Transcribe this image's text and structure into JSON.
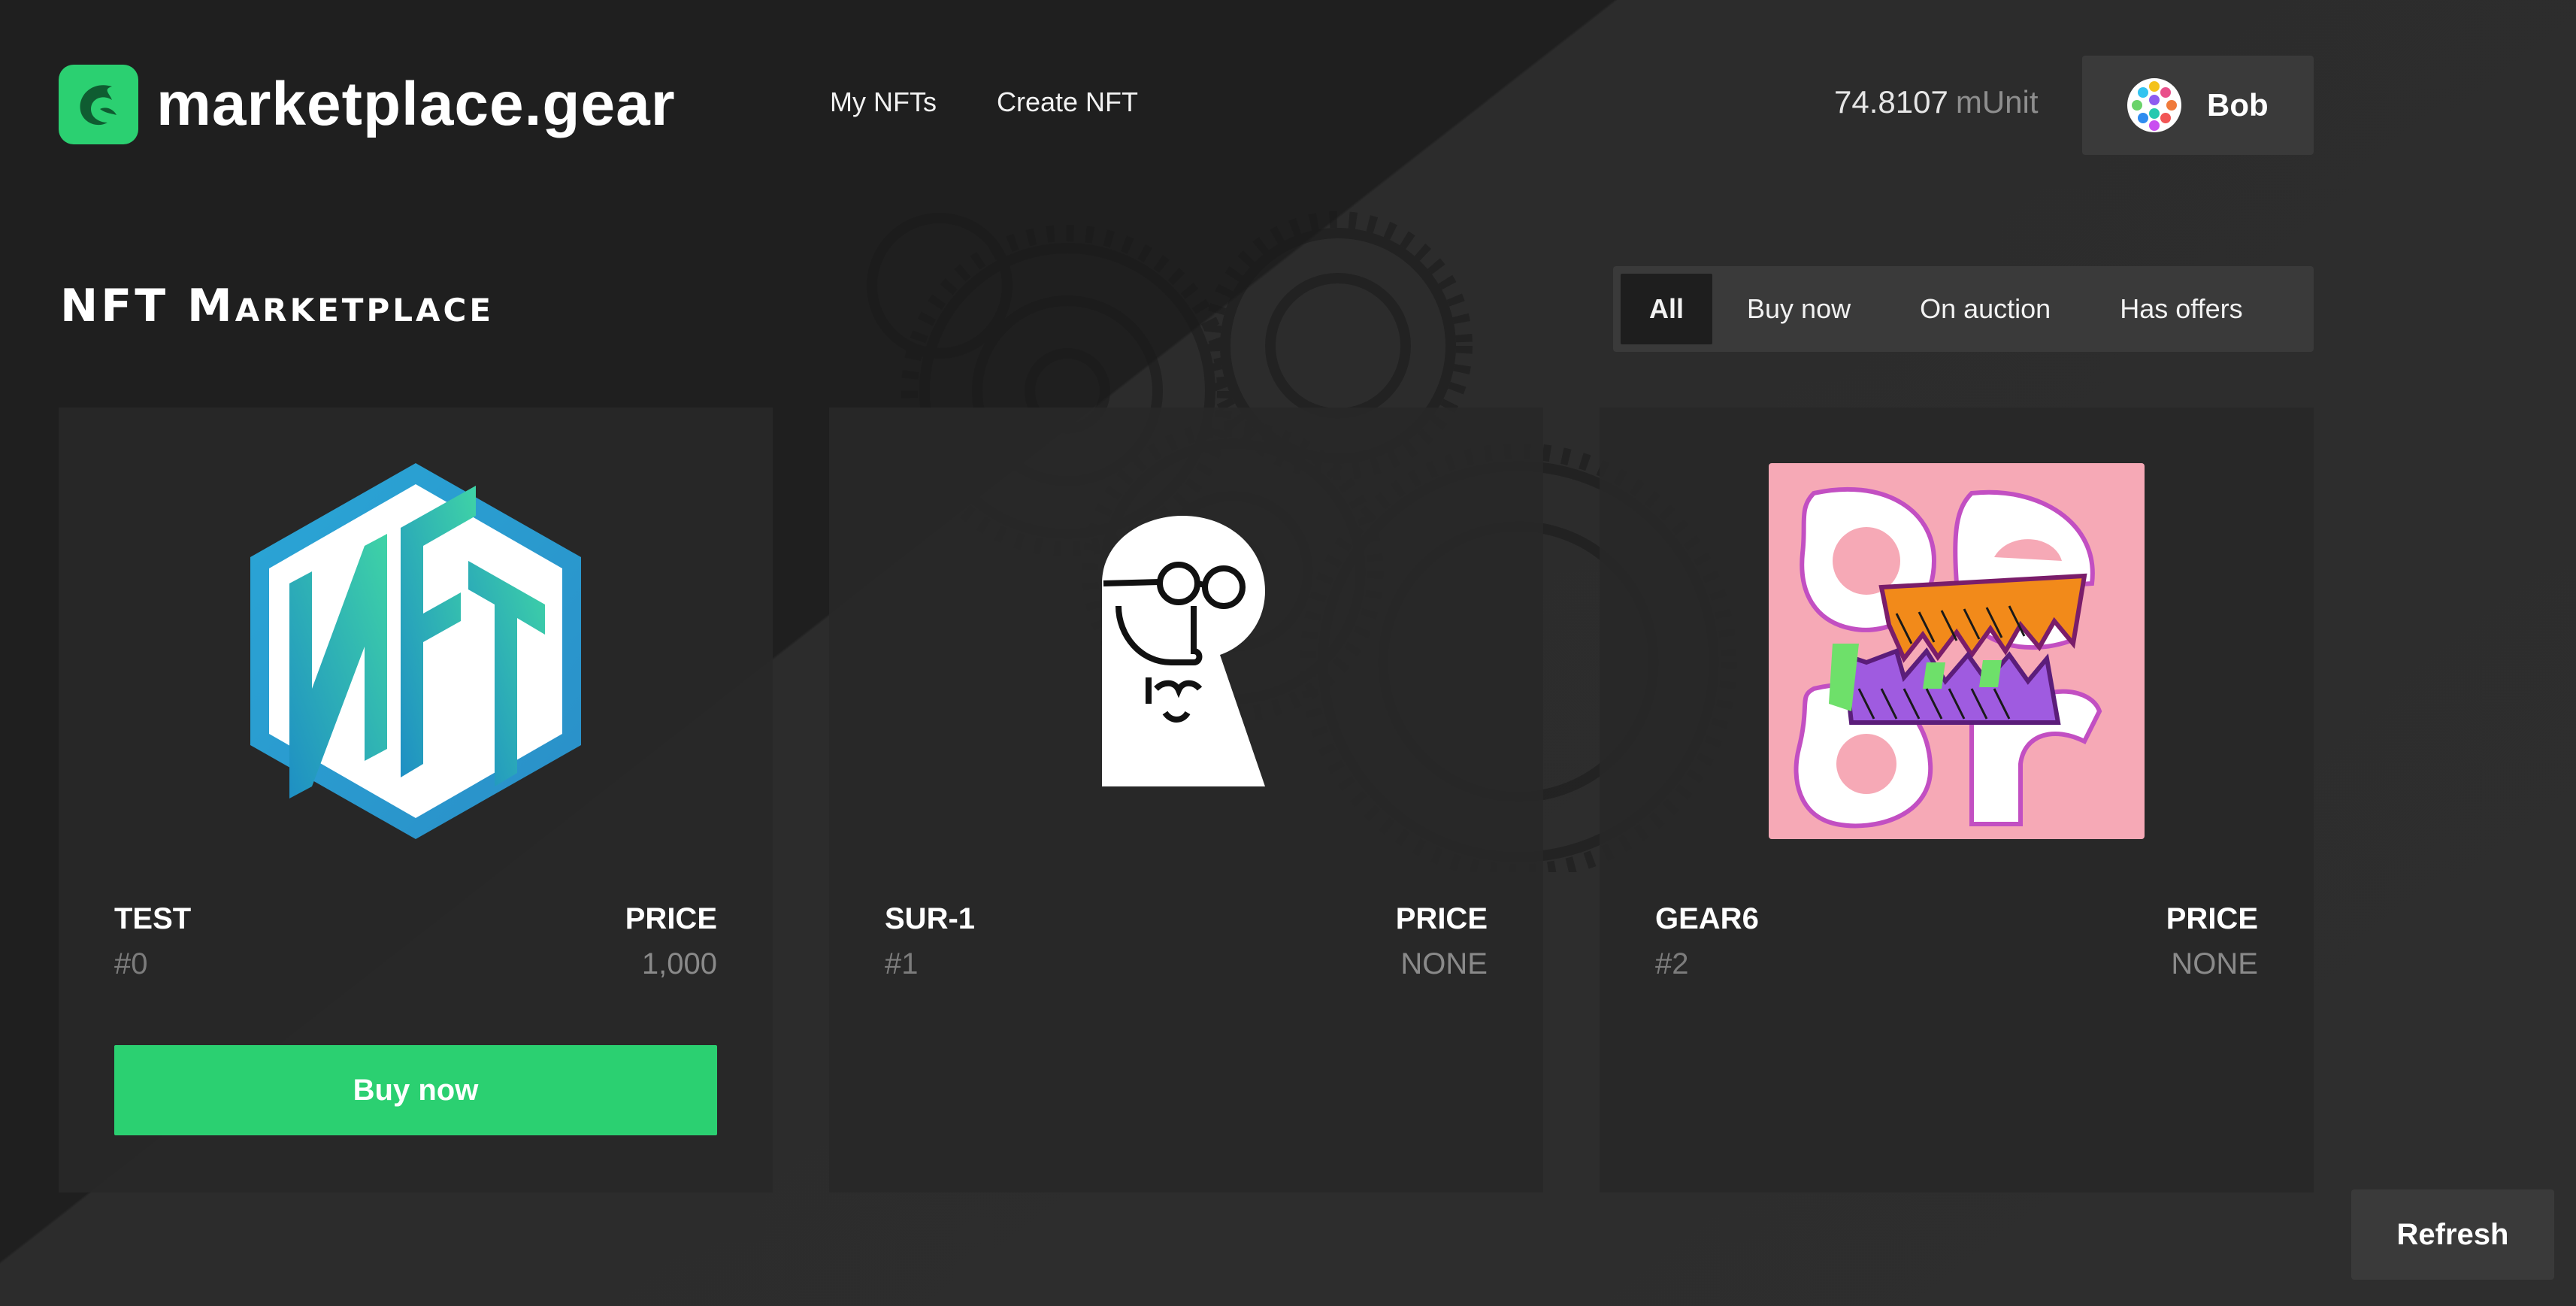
{
  "header": {
    "logo_text": "marketplace.gear",
    "nav": [
      {
        "label": "My NFTs"
      },
      {
        "label": "Create NFT"
      }
    ],
    "balance": {
      "value": "74.8107",
      "unit": "mUnit"
    },
    "account": {
      "name": "Bob"
    }
  },
  "section": {
    "title": "NFT Marketplace",
    "filters": [
      {
        "label": "All",
        "active": true
      },
      {
        "label": "Buy now",
        "active": false
      },
      {
        "label": "On auction",
        "active": false
      },
      {
        "label": "Has offers",
        "active": false
      }
    ]
  },
  "cards": [
    {
      "name": "TEST",
      "id": "#0",
      "price_label": "PRICE",
      "price": "1,000",
      "action": "Buy now",
      "image": "nft-hexagon-logo"
    },
    {
      "name": "SUR-1",
      "id": "#1",
      "price_label": "PRICE",
      "price": "NONE",
      "image": "bald-man-glasses-illustration"
    },
    {
      "name": "GEAR6",
      "id": "#2",
      "price_label": "PRICE",
      "price": "NONE",
      "image": "gear-pink-typography-art"
    }
  ],
  "refresh_label": "Refresh",
  "colors": {
    "accent": "#2bd071",
    "background": "#282828",
    "panel": "#3a3a3a"
  }
}
